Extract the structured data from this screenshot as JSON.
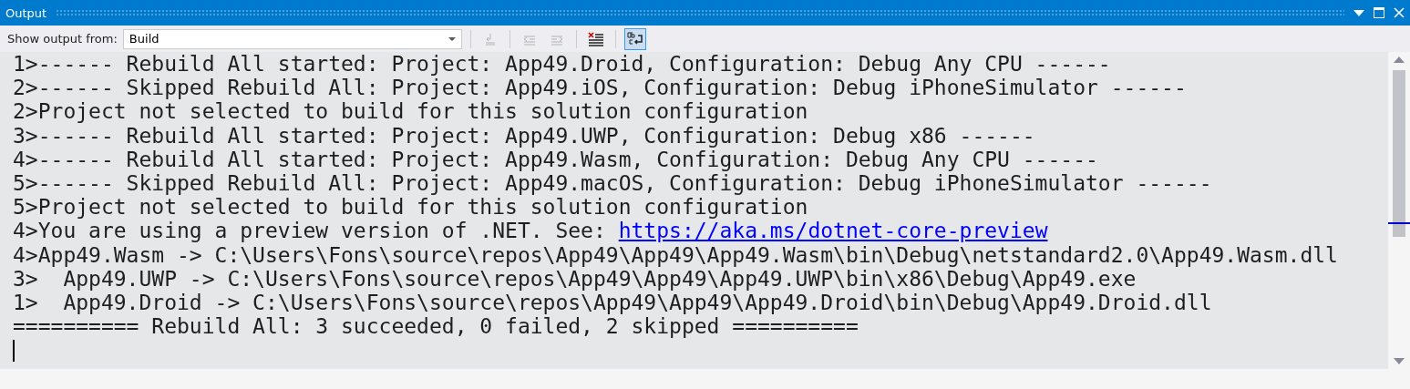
{
  "window": {
    "title": "Output"
  },
  "toolbar": {
    "label": "Show output from:",
    "source": "Build",
    "buttons": [
      {
        "kind": "find-message",
        "disabled": true,
        "selected": false
      },
      {
        "kind": "prev",
        "disabled": true,
        "selected": false
      },
      {
        "kind": "next",
        "disabled": true,
        "selected": false
      },
      {
        "kind": "clear",
        "disabled": false,
        "selected": false
      },
      {
        "kind": "wrap",
        "disabled": false,
        "selected": true
      }
    ]
  },
  "lines": [
    {
      "text": "1>------ Rebuild All started: Project: App49.Droid, Configuration: Debug Any CPU ------"
    },
    {
      "text": "2>------ Skipped Rebuild All: Project: App49.iOS, Configuration: Debug iPhoneSimulator ------"
    },
    {
      "text": "2>Project not selected to build for this solution configuration"
    },
    {
      "text": "3>------ Rebuild All started: Project: App49.UWP, Configuration: Debug x86 ------"
    },
    {
      "text": "4>------ Rebuild All started: Project: App49.Wasm, Configuration: Debug Any CPU ------"
    },
    {
      "text": "5>------ Skipped Rebuild All: Project: App49.macOS, Configuration: Debug iPhoneSimulator ------"
    },
    {
      "text": "5>Project not selected to build for this solution configuration"
    },
    {
      "text": "4>You are using a preview version of .NET. See: ",
      "link": "https://aka.ms/dotnet-core-preview"
    },
    {
      "text": "4>App49.Wasm -> C:\\Users\\Fons\\source\\repos\\App49\\App49\\App49.Wasm\\bin\\Debug\\netstandard2.0\\App49.Wasm.dll"
    },
    {
      "text": "3>  App49.UWP -> C:\\Users\\Fons\\source\\repos\\App49\\App49\\App49.UWP\\bin\\x86\\Debug\\App49.exe"
    },
    {
      "text": "1>  App49.Droid -> C:\\Users\\Fons\\source\\repos\\App49\\App49\\App49.Droid\\bin\\Debug\\App49.Droid.dll"
    },
    {
      "text": "========== Rebuild All: 3 succeeded, 0 failed, 2 skipped =========="
    }
  ]
}
